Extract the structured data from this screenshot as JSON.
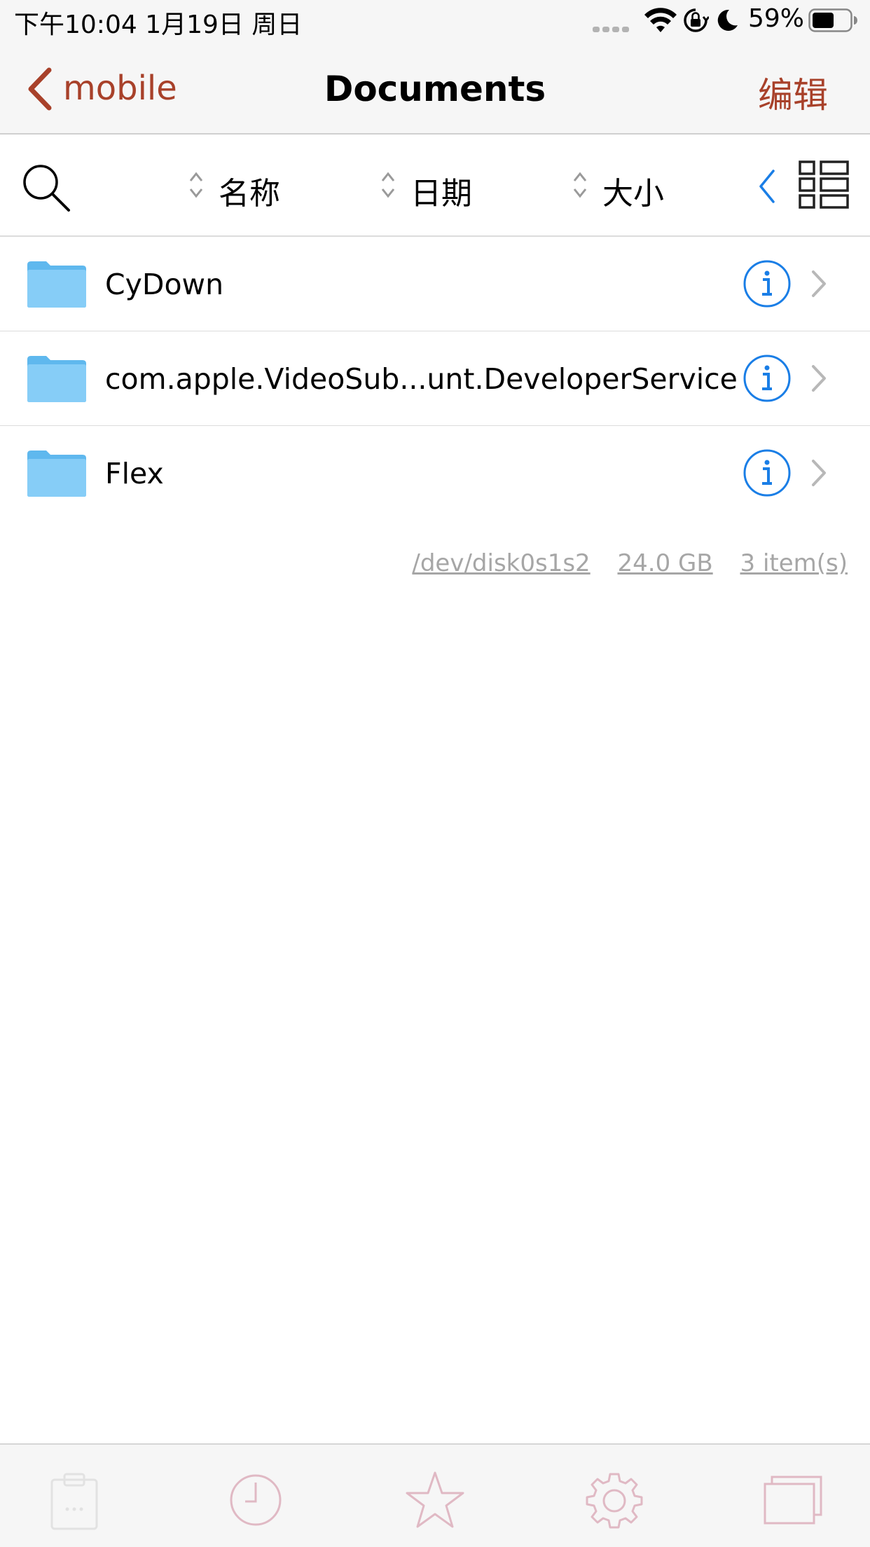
{
  "status_bar": {
    "time_date": "下午10:04   1月19日 周日",
    "battery_percent": "59%",
    "battery_level": 0.59
  },
  "nav": {
    "back_label": "mobile",
    "title": "Documents",
    "edit_label": "编辑"
  },
  "toolbar": {
    "sort_name": "名称",
    "sort_date": "日期",
    "sort_size": "大小"
  },
  "files": [
    {
      "name": "CyDown"
    },
    {
      "name": "com.apple.VideoSub...unt.DeveloperService"
    },
    {
      "name": "Flex"
    }
  ],
  "stats": {
    "device": "/dev/disk0s1s2",
    "capacity": "24.0 GB",
    "count": "3 item(s)"
  },
  "tabs": [
    "clipboard-icon",
    "clock-icon",
    "star-icon",
    "gear-icon",
    "windows-icon"
  ],
  "colors": {
    "accent": "#a8412a",
    "info_blue": "#1a7ee6",
    "folder_blue": "#7cc8f5",
    "tab_icon": "#e0b9c4"
  }
}
